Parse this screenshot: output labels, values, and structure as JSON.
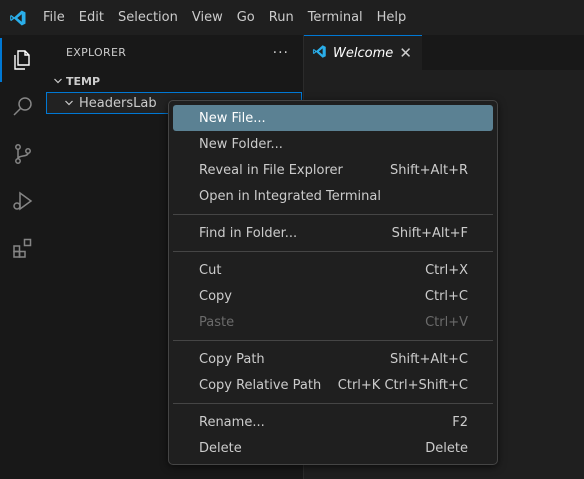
{
  "titlebar": {
    "menu": [
      "File",
      "Edit",
      "Selection",
      "View",
      "Go",
      "Run",
      "Terminal",
      "Help"
    ]
  },
  "activitybar": {
    "icons": [
      "explorer-icon",
      "search-icon",
      "source-control-icon",
      "run-debug-icon",
      "extensions-icon"
    ]
  },
  "sidebar": {
    "title": "EXPLORER",
    "more": "···",
    "section": "TEMP",
    "folder": "HeadersLab"
  },
  "editor": {
    "tab_label": "Welcome",
    "tab_close": "✕"
  },
  "context_menu": {
    "groups": [
      [
        {
          "label": "New File...",
          "shortcut": "",
          "state": "active"
        },
        {
          "label": "New Folder...",
          "shortcut": "",
          "state": "normal"
        },
        {
          "label": "Reveal in File Explorer",
          "shortcut": "Shift+Alt+R",
          "state": "normal"
        },
        {
          "label": "Open in Integrated Terminal",
          "shortcut": "",
          "state": "normal"
        }
      ],
      [
        {
          "label": "Find in Folder...",
          "shortcut": "Shift+Alt+F",
          "state": "normal"
        }
      ],
      [
        {
          "label": "Cut",
          "shortcut": "Ctrl+X",
          "state": "normal"
        },
        {
          "label": "Copy",
          "shortcut": "Ctrl+C",
          "state": "normal"
        },
        {
          "label": "Paste",
          "shortcut": "Ctrl+V",
          "state": "disabled"
        }
      ],
      [
        {
          "label": "Copy Path",
          "shortcut": "Shift+Alt+C",
          "state": "normal"
        },
        {
          "label": "Copy Relative Path",
          "shortcut": "Ctrl+K Ctrl+Shift+C",
          "state": "normal"
        }
      ],
      [
        {
          "label": "Rename...",
          "shortcut": "F2",
          "state": "normal"
        },
        {
          "label": "Delete",
          "shortcut": "Delete",
          "state": "normal"
        }
      ]
    ]
  },
  "colors": {
    "accent": "#0078d4",
    "logo": "#2aaeea",
    "menu_highlight": "#5b8193"
  }
}
